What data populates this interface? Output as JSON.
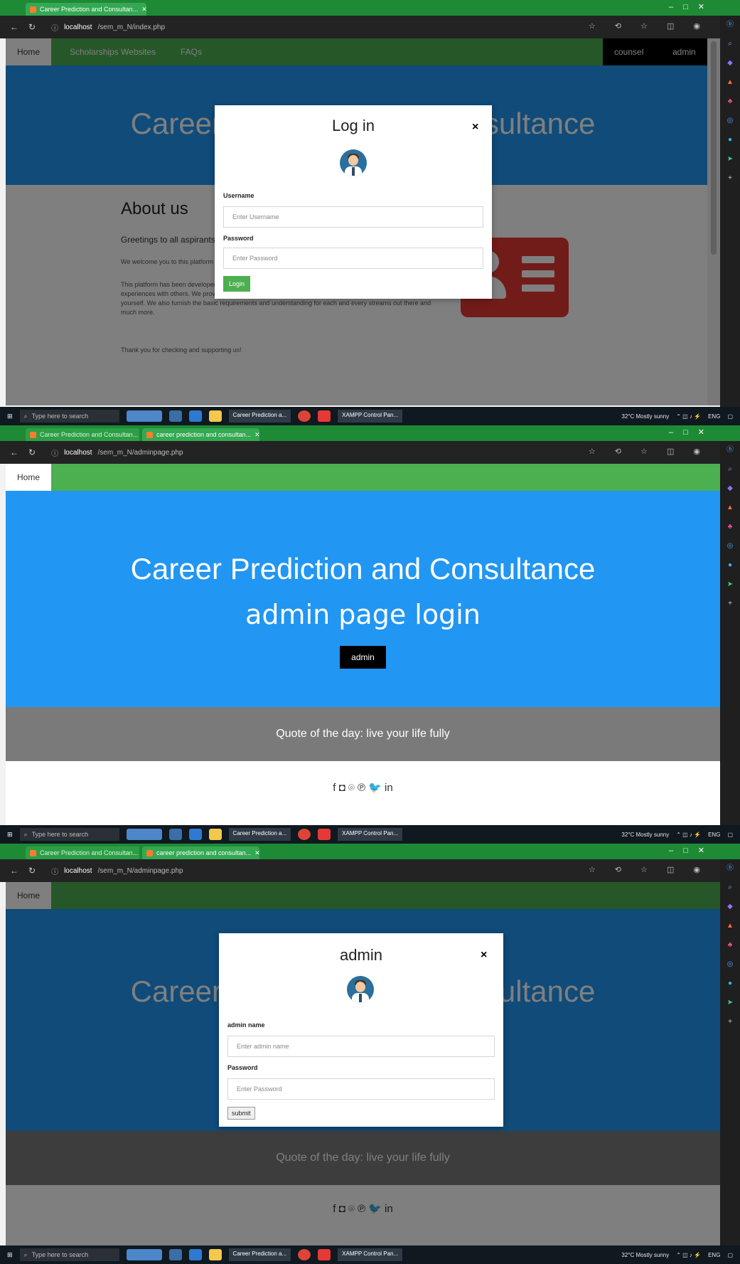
{
  "screens": {
    "s1": {
      "tabs": [
        "Career Prediction and Consultan..."
      ],
      "url_host": "localhost",
      "url_path": "/sem_m_N/index.php",
      "nav": {
        "home": "Home",
        "scholarships": "Scholarships Websites",
        "faqs": "FAQs",
        "counsel": "counsel",
        "admin": "admin"
      },
      "hero_title": "Career Prediction and Consultance",
      "about": {
        "title": "About us",
        "greeting": "Greetings to all aspirants",
        "para1": "We welcome you to this platform which provides solutions for your career",
        "para2": "This platform has been developed with a vision to give everyone a chance, solve their queries and share their experiences with others. We provide aptitude tests for you to understand yourself and how you could improve yourself. We also furnish the basic requirements and understanding for each and every streams out there and much more.",
        "thanks": "Thank you for checking and supporting us!"
      },
      "modal": {
        "title": "Log in",
        "close": "×",
        "username_label": "Username",
        "username_placeholder": "Enter Username",
        "password_label": "Password",
        "password_placeholder": "Enter Password",
        "button": "Login"
      }
    },
    "s2": {
      "tabs": [
        "Career Prediction and Consultan...",
        "career prediction and consultan..."
      ],
      "url_host": "localhost",
      "url_path": "/sem_m_N/adminpage.php",
      "nav_home": "Home",
      "hero_title": "Career Prediction and Consultance",
      "hero_subtitle": "admin page login",
      "admin_button": "admin",
      "quote": "Quote of the day: live your life fully",
      "social_icons": [
        "facebook-icon",
        "instagram-icon",
        "pinterest-icon",
        "twitter-icon",
        "linkedin-icon"
      ],
      "social": "f ◘ ⌾ ℗ 🐦 in"
    },
    "s3": {
      "tabs": [
        "Career Prediction and Consultan...",
        "career prediction and consultan..."
      ],
      "url_host": "localhost",
      "url_path": "/sem_m_N/adminpage.php",
      "nav_home": "Home",
      "hero_title": "Career Prediction and Consultance",
      "quote": "Quote of the day: live your life fully",
      "modal": {
        "title": "admin",
        "close": "×",
        "name_label": "admin name",
        "name_placeholder": "Enter admin name",
        "password_label": "Password",
        "password_placeholder": "Enter Password",
        "button": "submit"
      }
    }
  },
  "taskbar": {
    "search_placeholder": "Type here to search",
    "task_browser": "Career Prediction a...",
    "task_xampp": "XAMPP Control Pan...",
    "weather": "32°C Mostly sunny",
    "lang": "ENG"
  },
  "colors": {
    "nav_green": "#4caf50",
    "hero_blue": "#2196f3",
    "quote_gray": "#7a7a7a",
    "login_green": "#4caf50",
    "about_icon_red": "#e53935"
  }
}
